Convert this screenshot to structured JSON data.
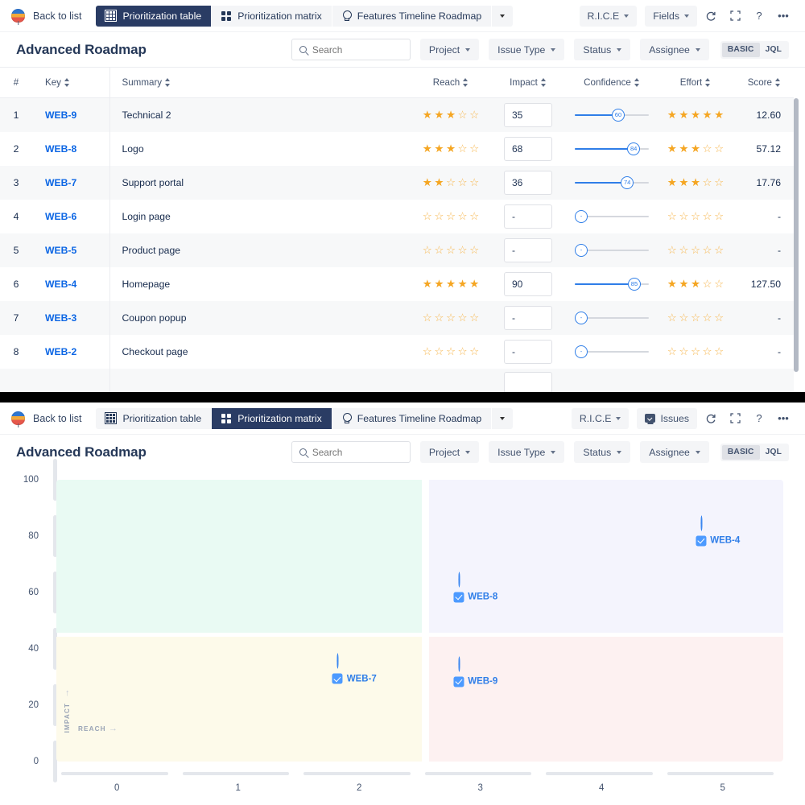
{
  "top_screen": {
    "nav": {
      "back_label": "Back to list",
      "tabs": [
        {
          "label": "Prioritization table",
          "icon": "grid-icon",
          "active": true
        },
        {
          "label": "Prioritization matrix",
          "icon": "quad-icon",
          "active": false
        },
        {
          "label": "Features Timeline Roadmap",
          "icon": "bulb-icon",
          "active": false
        }
      ],
      "tab_caret_icon": "chevron-down-icon",
      "right_controls": [
        {
          "label": "R.I.C.E",
          "type": "dropdown"
        },
        {
          "label": "Fields",
          "type": "dropdown"
        }
      ],
      "refresh_icon": "refresh-icon",
      "fullscreen_icon": "fullscreen-icon",
      "help_icon": "help-icon",
      "more_icon": "more-icon"
    },
    "header": {
      "title": "Advanced Roadmap",
      "search_placeholder": "Search",
      "search_value": "",
      "search_icon": "search-icon",
      "filters": [
        "Project",
        "Issue Type",
        "Status",
        "Assignee"
      ],
      "mode_basic": "BASIC",
      "mode_jql": "JQL",
      "mode_selected": "BASIC"
    },
    "table": {
      "columns": [
        "#",
        "Key",
        "Summary",
        "Reach",
        "Impact",
        "Confidence",
        "Effort",
        "Score"
      ],
      "rows": [
        {
          "idx": "1",
          "key": "WEB-9",
          "summary": "Technical 2",
          "reach": 3,
          "impact": "35",
          "confidence": "60",
          "confidence_pct": 60,
          "effort": 5,
          "score": "12.60"
        },
        {
          "idx": "2",
          "key": "WEB-8",
          "summary": "Logo",
          "reach": 3,
          "impact": "68",
          "confidence": "84",
          "confidence_pct": 84,
          "effort": 3,
          "score": "57.12"
        },
        {
          "idx": "3",
          "key": "WEB-7",
          "summary": "Support portal",
          "reach": 2,
          "impact": "36",
          "confidence": "74",
          "confidence_pct": 74,
          "effort": 3,
          "score": "17.76"
        },
        {
          "idx": "4",
          "key": "WEB-6",
          "summary": "Login page",
          "reach": 0,
          "impact": "-",
          "confidence": "-",
          "confidence_pct": 0,
          "effort": 0,
          "score": "-"
        },
        {
          "idx": "5",
          "key": "WEB-5",
          "summary": "Product page",
          "reach": 0,
          "impact": "-",
          "confidence": "-",
          "confidence_pct": 0,
          "effort": 0,
          "score": "-"
        },
        {
          "idx": "6",
          "key": "WEB-4",
          "summary": "Homepage",
          "reach": 5,
          "impact": "90",
          "confidence": "85",
          "confidence_pct": 85,
          "effort": 3,
          "score": "127.50"
        },
        {
          "idx": "7",
          "key": "WEB-3",
          "summary": "Coupon popup",
          "reach": 0,
          "impact": "-",
          "confidence": "-",
          "confidence_pct": 0,
          "effort": 0,
          "score": "-"
        },
        {
          "idx": "8",
          "key": "WEB-2",
          "summary": "Checkout page",
          "reach": 0,
          "impact": "-",
          "confidence": "-",
          "confidence_pct": 0,
          "effort": 0,
          "score": "-"
        }
      ]
    }
  },
  "bottom_screen": {
    "nav": {
      "back_label": "Back to list",
      "tabs": [
        {
          "label": "Prioritization table",
          "icon": "grid-icon",
          "active": false
        },
        {
          "label": "Prioritization matrix",
          "icon": "quad-icon",
          "active": true
        },
        {
          "label": "Features Timeline Roadmap",
          "icon": "bulb-icon",
          "active": false
        }
      ],
      "tab_caret_icon": "chevron-down-icon",
      "rice_label": "R.I.C.E",
      "issues_label": "Issues",
      "issues_icon": "monitor-icon",
      "refresh_icon": "refresh-icon",
      "fullscreen_icon": "fullscreen-icon",
      "help_icon": "help-icon",
      "more_icon": "more-icon"
    },
    "header": {
      "title": "Advanced Roadmap",
      "search_placeholder": "Search",
      "search_value": "",
      "search_icon": "search-icon",
      "filters": [
        "Project",
        "Issue Type",
        "Status",
        "Assignee"
      ],
      "mode_basic": "BASIC",
      "mode_jql": "JQL",
      "mode_selected": "BASIC"
    }
  },
  "chart_data": {
    "type": "scatter",
    "title": "",
    "xlabel": "REACH",
    "ylabel": "IMPACT",
    "xlim": [
      0,
      5
    ],
    "ylim": [
      0,
      110
    ],
    "x_ticks": [
      "0",
      "1",
      "2",
      "3",
      "4",
      "5"
    ],
    "y_ticks": [
      "0",
      "20",
      "40",
      "60",
      "80",
      "100"
    ],
    "grid": false,
    "legend": "none",
    "quadrants": [
      {
        "name": "top-left",
        "color": "#e9faf3"
      },
      {
        "name": "top-right",
        "color": "#f4f4fd"
      },
      {
        "name": "bottom-left",
        "color": "#fdfaea"
      },
      {
        "name": "bottom-right",
        "color": "#fdf1f1"
      }
    ],
    "points": [
      {
        "label": "WEB-4",
        "x": 5,
        "y": 90,
        "checked": true,
        "color": "#4c9aff"
      },
      {
        "label": "WEB-8",
        "x": 3,
        "y": 68,
        "checked": true,
        "color": "#4c9aff"
      },
      {
        "label": "WEB-7",
        "x": 2,
        "y": 36,
        "checked": true,
        "color": "#4c9aff"
      },
      {
        "label": "WEB-9",
        "x": 3,
        "y": 35,
        "checked": true,
        "color": "#4c9aff"
      }
    ]
  }
}
